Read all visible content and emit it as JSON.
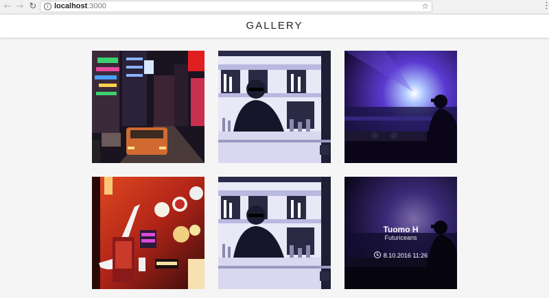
{
  "browser": {
    "url_host": "localhost",
    "url_port": ":3000",
    "icons": {
      "back": "back-arrow-icon",
      "forward": "forward-arrow-icon",
      "reload": "reload-icon",
      "info": "info-icon",
      "bookmark": "star-icon",
      "menu": "kebab-menu-icon"
    }
  },
  "header": {
    "title": "GALLERY"
  },
  "gallery": {
    "tiles": [
      {
        "subject": "city-night-street"
      },
      {
        "subject": "bartender"
      },
      {
        "subject": "concert-dj"
      },
      {
        "subject": "neon-signs"
      },
      {
        "subject": "bartender"
      },
      {
        "subject": "concert-dj",
        "hovered": true
      }
    ],
    "hover_card": {
      "name": "Tuomo H",
      "subtitle": "Futuriceans",
      "date": "8.10.2016 11:26",
      "icon": "clock-icon"
    }
  }
}
